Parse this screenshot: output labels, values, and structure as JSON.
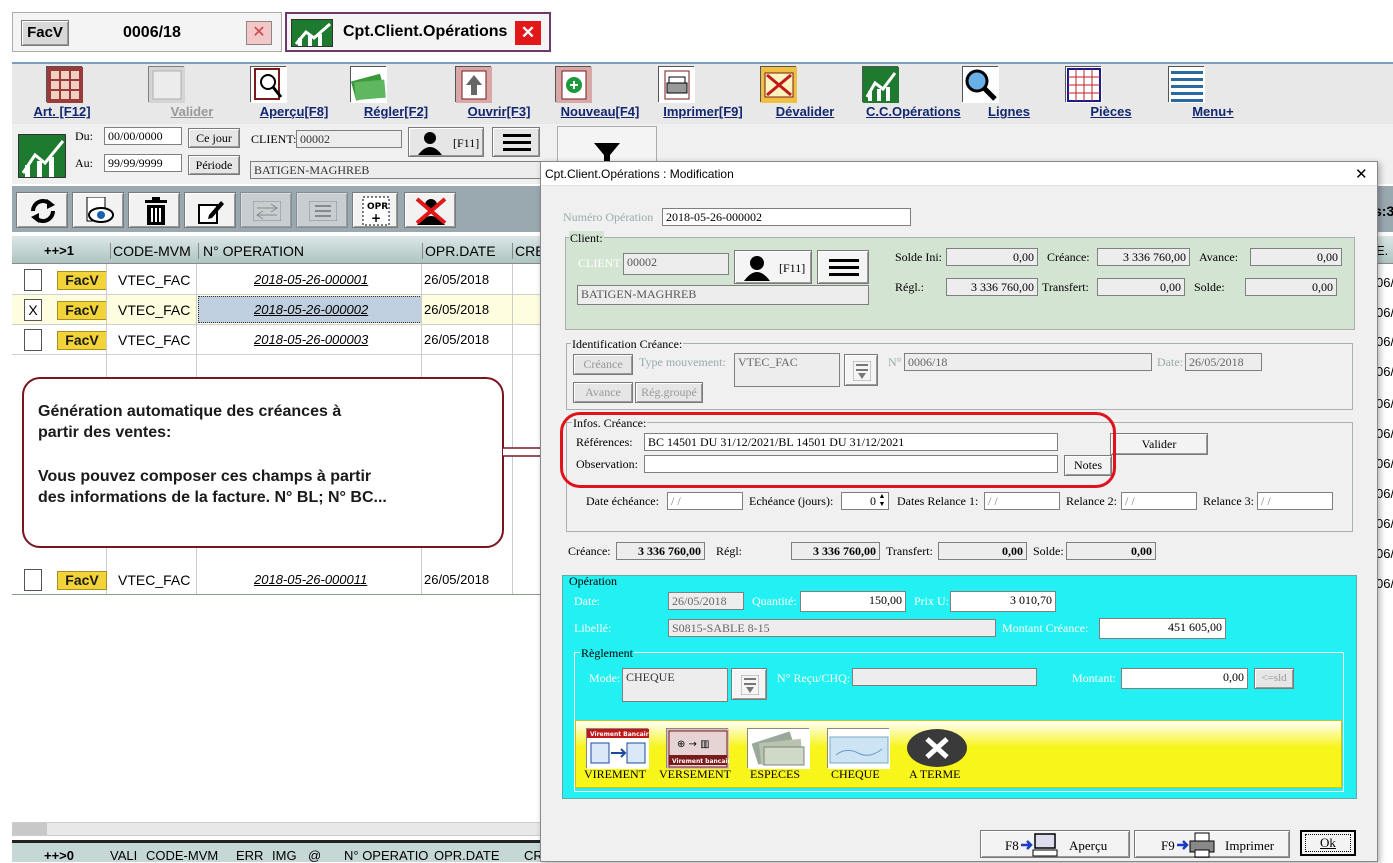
{
  "tabs": {
    "tab1_icon": "FacV",
    "tab1_label": "0006/18",
    "tab2_label": "Cpt.Client.Opérations"
  },
  "toolbar": [
    {
      "label": "Art. [F12]",
      "icon": "articles-icon"
    },
    {
      "label": "Valider",
      "icon": "validate-icon"
    },
    {
      "label": "Aperçu[F8]",
      "icon": "preview-icon"
    },
    {
      "label": "Régler[F2]",
      "icon": "money-icon"
    },
    {
      "label": "Ouvrir[F3]",
      "icon": "open-icon"
    },
    {
      "label": "Nouveau[F4]",
      "icon": "new-icon"
    },
    {
      "label": "Imprimer[F9]",
      "icon": "printer-icon"
    },
    {
      "label": "Dévalider",
      "icon": "unvalidate-icon"
    },
    {
      "label": "C.C.Opérations",
      "icon": "chart-icon"
    },
    {
      "label": "Lignes",
      "icon": "search-icon"
    },
    {
      "label": "Pièces",
      "icon": "grid-icon"
    },
    {
      "label": "Menu+",
      "icon": "menu-icon"
    }
  ],
  "filter": {
    "du_label": "Du:",
    "du_value": "00/00/0000",
    "au_label": "Au:",
    "au_value": "99/99/9999",
    "cejour": "Ce jour",
    "periode": "Période",
    "client_label": "CLIENT:",
    "client_code": "00002",
    "f11": "[F11]",
    "client_name": "BATIGEN-MAGHREB"
  },
  "table": {
    "headers": [
      "++>1",
      "CODE-MVM",
      "N° OPERATION",
      "OPR.DATE",
      "CRE"
    ],
    "rows": [
      {
        "check": "",
        "badge": "FacV",
        "code": "VTEC_FAC",
        "op": "2018-05-26-000001",
        "date": "26/05/2018"
      },
      {
        "check": "X",
        "badge": "FacV",
        "code": "VTEC_FAC",
        "op": "2018-05-26-000002",
        "date": "26/05/2018"
      },
      {
        "check": "",
        "badge": "FacV",
        "code": "VTEC_FAC",
        "op": "2018-05-26-000003",
        "date": "26/05/2018"
      },
      {
        "check": "",
        "badge": "FacV",
        "code": "VTEC_FAC",
        "op": "2018-05-26-000011",
        "date": "26/05/2018"
      }
    ],
    "right_strip": [
      "E.",
      "06/",
      "06/",
      "06/",
      "06/",
      "06/",
      "06/",
      "06/",
      "06/",
      "06/",
      "06/",
      "06/"
    ],
    "right_label": "s:3",
    "footer_headers": [
      "++>0",
      "VALI",
      "CODE-MVM",
      "ERR",
      "IMG",
      "@",
      "N° OPERATIO",
      "OPR.DATE",
      "CRE"
    ]
  },
  "callout": {
    "line1": "Génération automatique des créances à",
    "line2": "partir des ventes:",
    "line3": "Vous pouvez composer ces champs  à partir",
    "line4": "des informations de la facture. N° BL; N° BC..."
  },
  "dialog": {
    "title": "Cpt.Client.Opérations : Modification",
    "num_op_label": "Numéro Opération",
    "num_op_value": "2018-05-26-000002",
    "client_group": "Client:",
    "client_label": "CLIENT",
    "client_code": "00002",
    "f11": "[F11]",
    "client_name": "BATIGEN-MAGHREB",
    "solde_ini_label": "Solde Ini:",
    "solde_ini": "0,00",
    "creance_label": "Créance:",
    "creance": "3 336 760,00",
    "avance_label": "Avance:",
    "avance": "0,00",
    "regl_label": "Régl.:",
    "regl": "3 336 760,00",
    "transfert_label": "Transfert:",
    "transfert": "0,00",
    "solde_label": "Solde:",
    "solde": "0,00",
    "ident_group": "Identification Créance:",
    "creance_btn": "Créance",
    "type_mvt_label": "Type mouvement:",
    "type_mvt": "VTEC_FAC",
    "no_label": "N°",
    "no_value": "0006/18",
    "date_label": "Date:",
    "date_value": "26/05/2018",
    "avance_btn": "Avance",
    "reg_groupe_btn": "Rég.groupé",
    "infos_group": "Infos. Créance:",
    "references_label": "Références:",
    "references": "BC 14501 DU 31/12/2021/BL 14501 DU 31/12/2021",
    "observation_label": "Observation:",
    "observation": "",
    "valider_btn": "Valider",
    "notes_btn": "Notes",
    "date_ech_label": "Date échéance:",
    "date_ech": " / /",
    "echeance_label": "Echéance (jours):",
    "echeance": "0",
    "relance1_label": "Dates Relance 1:",
    "relance1": " / /",
    "relance2_label": "Relance 2:",
    "relance2": " / /",
    "relance3_label": "Relance 3:",
    "relance3": " / /",
    "sum_creance_label": "Créance:",
    "sum_creance": "3 336 760,00",
    "sum_regl_label": "Régl:",
    "sum_regl": "3 336 760,00",
    "sum_transfert_label": "Transfert:",
    "sum_transfert": "0,00",
    "sum_solde_label": "Solde:",
    "sum_solde": "0,00",
    "operation_group": "Opération",
    "op_date_label": "Date:",
    "op_date": "26/05/2018",
    "quantite_label": "Quantité:",
    "quantite": "150,00",
    "prixu_label": "Prix U:",
    "prixu": "3 010,70",
    "libelle_label": "Libellé:",
    "libelle": "S0815-SABLE 8-15",
    "montant_creance_label": "Montant Créance:",
    "montant_creance": "451 605,00",
    "reglement_group": "Règlement",
    "mode_label": "Mode:",
    "mode": "CHEQUE",
    "recu_label": "N° Reçu/CHQ:",
    "recu": "",
    "montant_label": "Montant:",
    "montant": "0,00",
    "sld_btn": "<=sld",
    "pay_methods": [
      {
        "label": "VIREMENT",
        "icon": "bank-transfer-icon",
        "caption": "Virement Bancaire"
      },
      {
        "label": "VERSEMENT",
        "icon": "deposit-icon",
        "caption": "Virement bancaire"
      },
      {
        "label": "ESPECES",
        "icon": "cash-icon",
        "caption": ""
      },
      {
        "label": "CHEQUE",
        "icon": "cheque-icon",
        "caption": ""
      },
      {
        "label": "A TERME",
        "icon": "close-circle-icon",
        "caption": ""
      }
    ],
    "apercu_btn": "Aperçu",
    "apercu_key": "F8",
    "imprimer_btn": "Imprimer",
    "imprimer_key": "F9",
    "ok_btn": "Ok"
  },
  "colors": {
    "dialog_green": "#d3e4d2",
    "cyan": "#22f0f2",
    "yellow": "#f7f51a",
    "callout_border": "#7a1520",
    "header_bg": "#c6d8d6"
  }
}
